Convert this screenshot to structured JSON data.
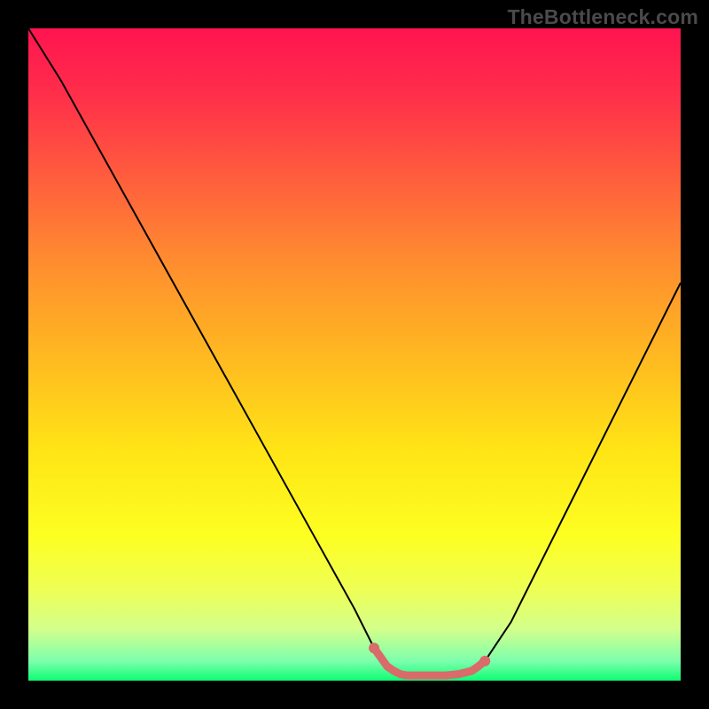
{
  "watermark": "TheBottleneck.com",
  "chart_data": {
    "type": "line",
    "title": "",
    "xlabel": "",
    "ylabel": "",
    "xlim": [
      0,
      100
    ],
    "ylim": [
      0,
      100
    ],
    "series": [
      {
        "name": "bottleneck-curve",
        "x": [
          0,
          5,
          10,
          15,
          20,
          25,
          30,
          35,
          40,
          45,
          50,
          53,
          56,
          58,
          60,
          64,
          68,
          70,
          74,
          78,
          82,
          86,
          90,
          94,
          98,
          100
        ],
        "values": [
          100,
          92,
          83,
          74,
          65,
          56,
          47,
          38,
          29,
          20,
          11,
          5,
          1.5,
          0.8,
          0.8,
          0.8,
          1.5,
          3,
          9,
          17,
          25,
          33,
          41,
          49,
          57,
          61
        ]
      }
    ],
    "optimal_segment": {
      "x": [
        53,
        55,
        56,
        57,
        58,
        60,
        62,
        64,
        66,
        68,
        69,
        70
      ],
      "values": [
        5,
        2.2,
        1.5,
        1.0,
        0.8,
        0.8,
        0.8,
        0.8,
        1.0,
        1.5,
        2.2,
        3.0
      ]
    },
    "gradient_stops": [
      {
        "offset": 0.0,
        "color": "#ff1450"
      },
      {
        "offset": 0.1,
        "color": "#ff2e4a"
      },
      {
        "offset": 0.22,
        "color": "#ff5a3e"
      },
      {
        "offset": 0.35,
        "color": "#ff8a30"
      },
      {
        "offset": 0.5,
        "color": "#ffb821"
      },
      {
        "offset": 0.65,
        "color": "#ffe516"
      },
      {
        "offset": 0.78,
        "color": "#fdff22"
      },
      {
        "offset": 0.86,
        "color": "#eeff55"
      },
      {
        "offset": 0.92,
        "color": "#d4ff8a"
      },
      {
        "offset": 0.97,
        "color": "#7dffad"
      },
      {
        "offset": 1.0,
        "color": "#0dfd72"
      }
    ],
    "curve_stroke": "#000000",
    "optimal_stroke": "#d96b6b"
  }
}
